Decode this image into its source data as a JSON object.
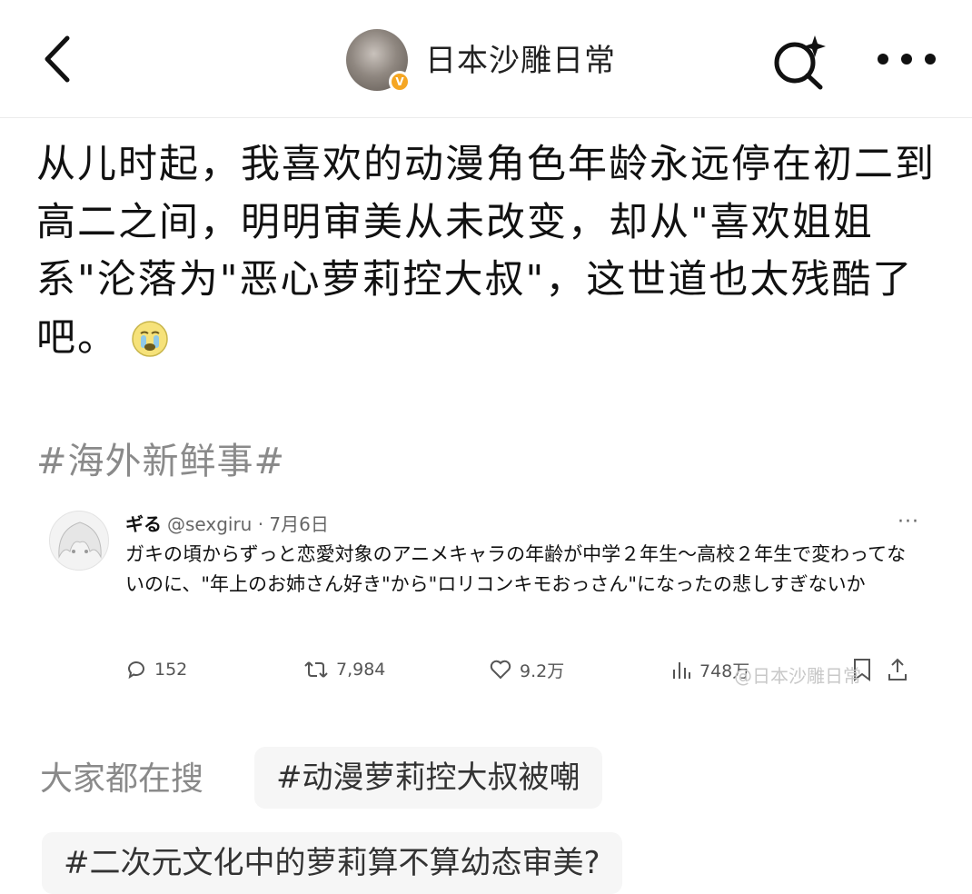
{
  "header": {
    "back_icon": "chevron-left-icon",
    "account_name": "日本沙雕日常",
    "verified_badge": "V",
    "search_icon": "sparkle-search-icon",
    "more_icon": "more-horizontal-icon"
  },
  "post": {
    "text": "从儿时起，我喜欢的动漫角色年龄永远停在初二到高二之间，明明审美从未改变，却从\"喜欢姐姐系\"沦落为\"恶心萝莉控大叔\"，这世道也太残酷了吧。",
    "emoji": "crying-face-emoji",
    "topic": "#海外新鲜事#"
  },
  "embedded_tweet": {
    "name": "ギる",
    "handle": "@sexgiru · 7月6日",
    "more": "···",
    "text": "ガキの頃からずっと恋愛対象のアニメキャラの年齢が中学２年生〜高校２年生で変わってないのに、\"年上のお姉さん好き\"から\"ロリコンキモおっさん\"になったの悲しすぎないか",
    "replies": "152",
    "retweets": "7,984",
    "likes": "9.2万",
    "views": "748万"
  },
  "watermark": "@日本沙雕日常",
  "searches": {
    "label": "大家都在搜",
    "chips": [
      "#动漫萝莉控大叔被嘲",
      "#二次元文化中的萝莉算不算幼态审美?"
    ]
  },
  "colors": {
    "accent_badge": "#f5a623",
    "muted_text": "#8a8a8a",
    "chip_bg": "#f6f6f6"
  }
}
